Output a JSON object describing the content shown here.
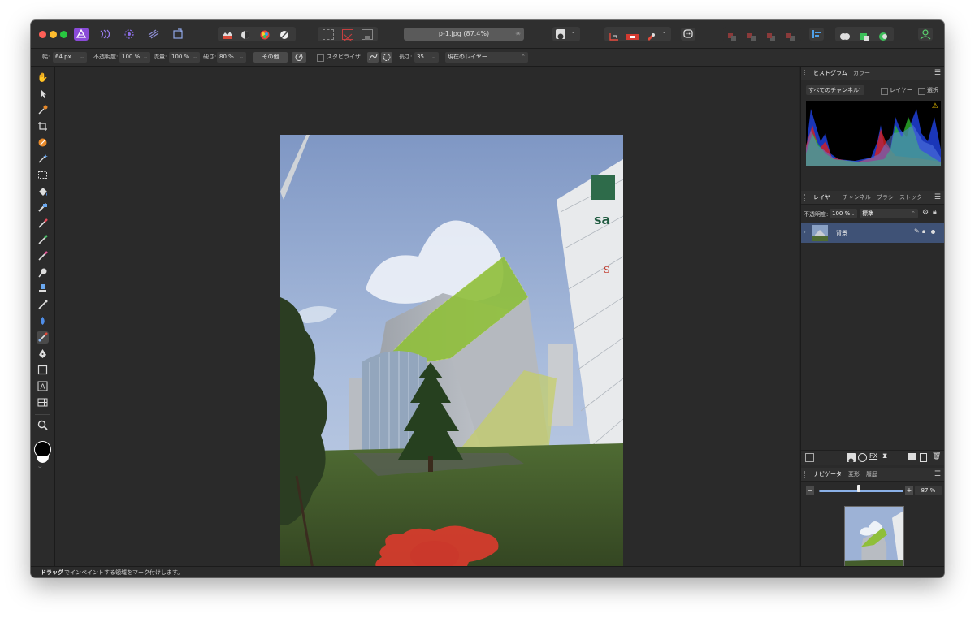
{
  "document": {
    "title": "p-1.jpg (87.4%)"
  },
  "context_toolbar": {
    "width_label": "幅:",
    "width_value": "64 px",
    "opacity_label": "不透明度:",
    "opacity_value": "100 %",
    "flow_label": "流量:",
    "flow_value": "100 %",
    "hardness_label": "硬さ:",
    "hardness_value": "80 %",
    "more_label": "その他",
    "stabilizer_label": "スタビライザ",
    "length_label": "長さ:",
    "length_value": "35",
    "layer_mode": "現在のレイヤー"
  },
  "histogram_panel": {
    "tabs": [
      "ヒストグラム",
      "カラー"
    ],
    "channel": "すべてのチャンネル",
    "layer_label": "レイヤー",
    "select_label": "選択"
  },
  "layers_panel": {
    "tabs": [
      "レイヤー",
      "チャンネル",
      "ブラシ",
      "ストック"
    ],
    "opacity_label": "不透明度:",
    "opacity_value": "100 %",
    "blend_mode": "標準",
    "layer_name": "背景"
  },
  "navigator_panel": {
    "tabs": [
      "ナビゲータ",
      "変形",
      "履歴"
    ],
    "zoom_value": "87 %"
  },
  "statusbar": {
    "bold": "ドラッグ",
    "text": "でインペイントする領域をマーク付けします。"
  },
  "colors": {
    "accent": "#3f5276",
    "inpaint_mark": "#e03a2e",
    "persona": "#8a4bd8"
  }
}
